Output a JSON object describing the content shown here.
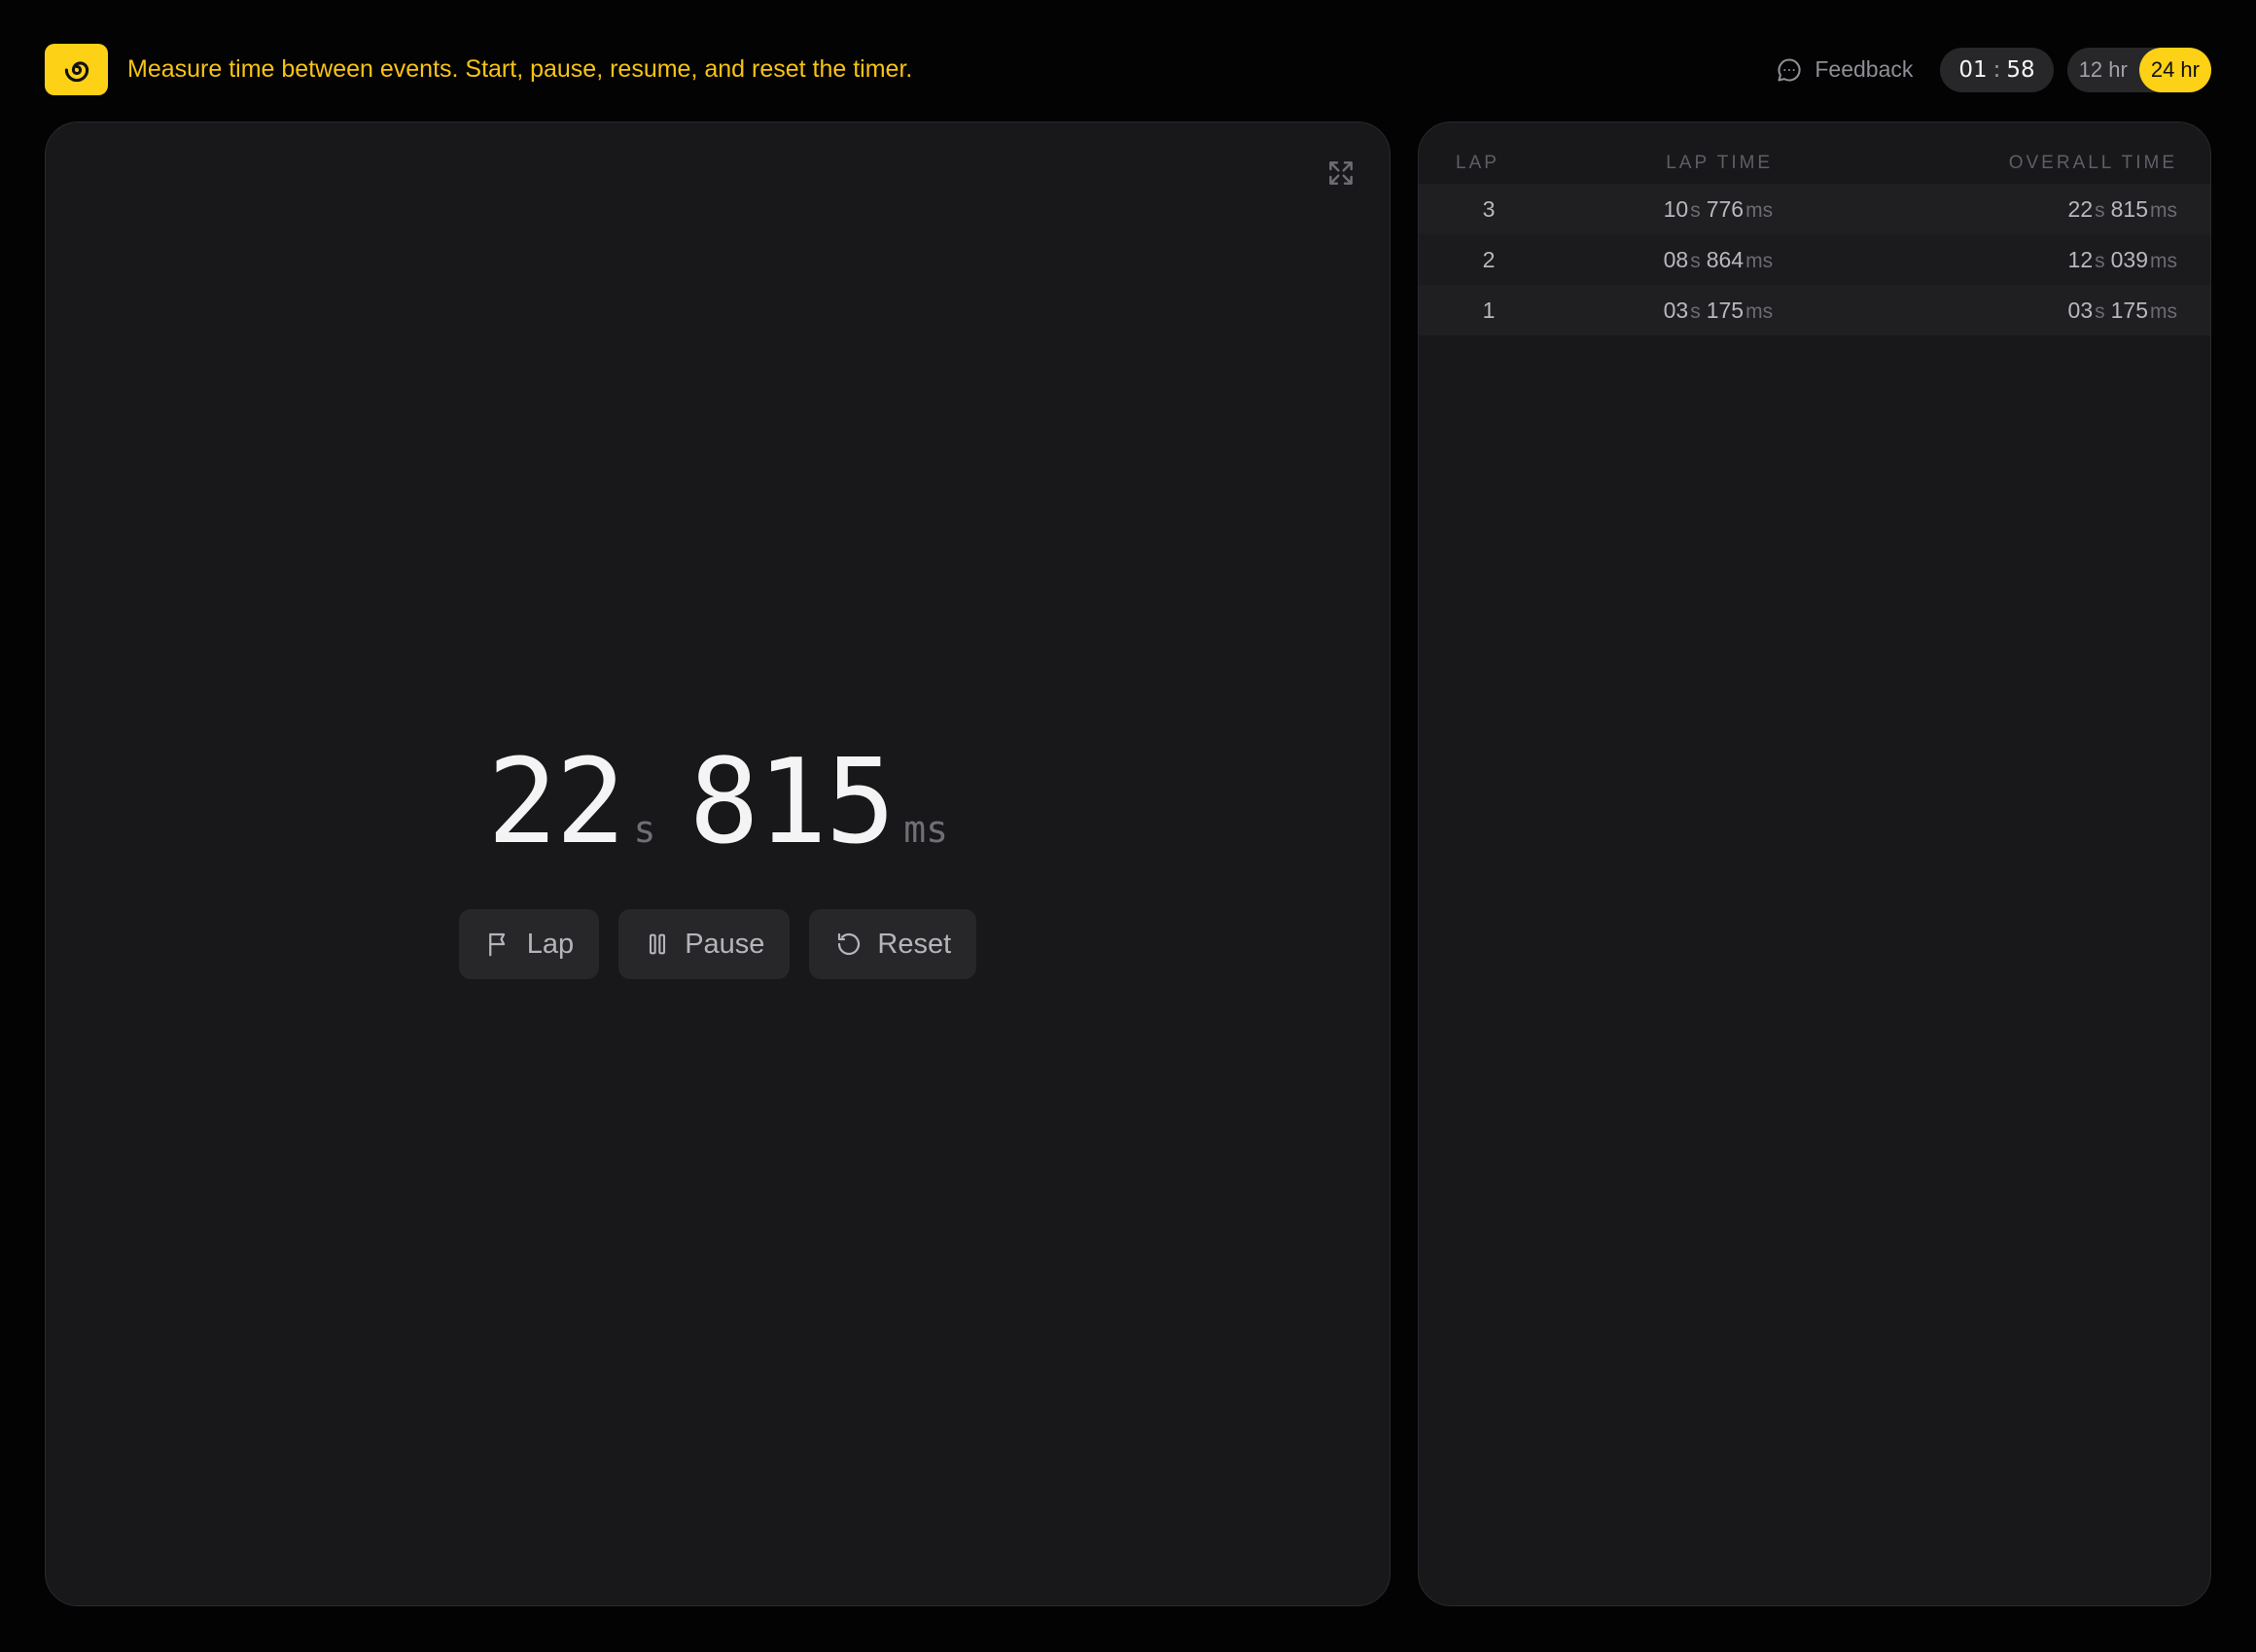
{
  "header": {
    "tagline": "Measure time between events. Start, pause, resume, and reset the timer.",
    "feedback_label": "Feedback",
    "clock": {
      "hours": "01",
      "separator": ":",
      "minutes": "58"
    },
    "time_format": {
      "options": [
        "12 hr",
        "24 hr"
      ],
      "selected": "24 hr"
    }
  },
  "stopwatch": {
    "seconds": "22",
    "seconds_unit": "s",
    "milliseconds": "815",
    "milliseconds_unit": "ms"
  },
  "controls": {
    "lap_label": "Lap",
    "pause_label": "Pause",
    "reset_label": "Reset"
  },
  "laps": {
    "headers": {
      "lap": "Lap",
      "lap_time": "Lap time",
      "overall_time": "Overall time"
    },
    "rows": [
      {
        "lap": "3",
        "lap_s": "10",
        "lap_ms": "776",
        "overall_s": "22",
        "overall_ms": "815"
      },
      {
        "lap": "2",
        "lap_s": "08",
        "lap_ms": "864",
        "overall_s": "12",
        "overall_ms": "039"
      },
      {
        "lap": "1",
        "lap_s": "03",
        "lap_ms": "175",
        "overall_s": "03",
        "overall_ms": "175"
      }
    ],
    "unit_s": "s",
    "unit_ms": "ms"
  },
  "colors": {
    "accent": "#fcd116",
    "tagline": "#f7c315",
    "background": "#030303",
    "panel": "#18181b"
  },
  "icons": {
    "logo": "spiral-icon",
    "feedback": "chat-bubble-icon",
    "expand": "fullscreen-icon",
    "lap": "flag-icon",
    "pause": "pause-icon",
    "reset": "reset-arrow-icon"
  }
}
